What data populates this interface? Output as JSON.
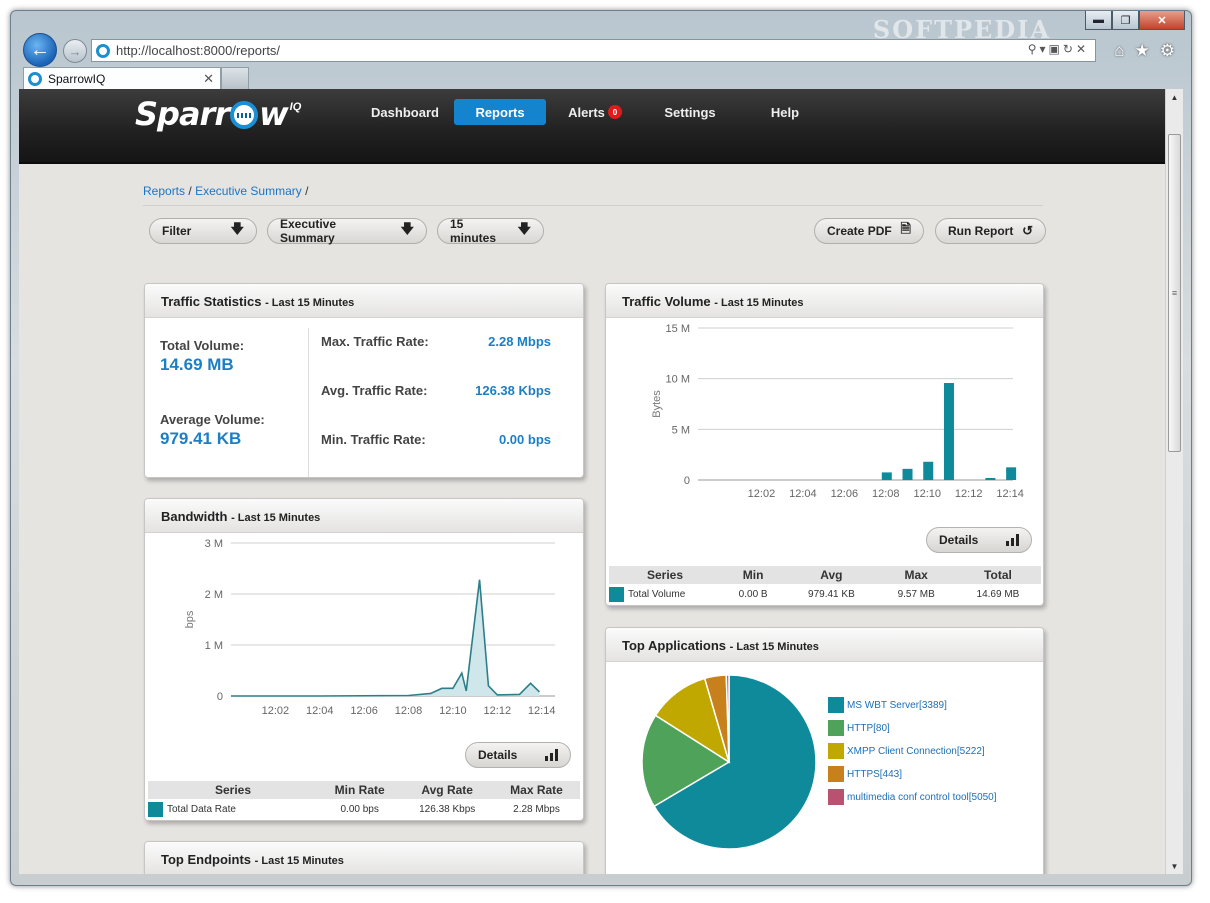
{
  "browser": {
    "watermark": "SOFTPEDIA",
    "url": "http://localhost:8000/reports/",
    "tab_title": "SparrowIQ",
    "controls": {
      "minimize": "▬",
      "maximize": "❐",
      "close": "✕"
    },
    "icons": [
      "home-icon",
      "star-icon",
      "gear-icon"
    ]
  },
  "app": {
    "logo": {
      "word_start": "Sparr",
      "word_end": "w",
      "sup": "IQ"
    },
    "nav": [
      {
        "label": "Dashboard",
        "active": false
      },
      {
        "label": "Reports",
        "active": true
      },
      {
        "label": "Alerts",
        "active": false,
        "badge": "0"
      },
      {
        "label": "Settings",
        "active": false
      },
      {
        "label": "Help",
        "active": false
      }
    ],
    "accent": "#1584cf",
    "badge_color": "#e01b1b"
  },
  "breadcrumb": {
    "items": [
      "Reports",
      "Executive Summary"
    ],
    "separator": "/"
  },
  "toolbar": {
    "filter": "Filter",
    "report": "Executive Summary",
    "time": "15 minutes",
    "create_pdf": "Create PDF",
    "run_report": "Run Report"
  },
  "traffic_stats": {
    "title": "Traffic Statistics",
    "subtitle": "- Last 15 Minutes",
    "total_volume_label": "Total Volume:",
    "total_volume": "14.69 MB",
    "average_volume_label": "Average Volume:",
    "average_volume": "979.41 KB",
    "max_rate_label": "Max. Traffic Rate:",
    "max_rate": "2.28 Mbps",
    "avg_rate_label": "Avg. Traffic Rate:",
    "avg_rate": "126.38 Kbps",
    "min_rate_label": "Min. Traffic Rate:",
    "min_rate": "0.00 bps"
  },
  "traffic_volume": {
    "title": "Traffic Volume",
    "subtitle": "- Last 15 Minutes",
    "details": "Details",
    "table": {
      "headers": [
        "Series",
        "Min",
        "Avg",
        "Max",
        "Total"
      ],
      "row": {
        "series": "Total Volume",
        "min": "0.00 B",
        "avg": "979.41 KB",
        "max": "9.57 MB",
        "total": "14.69 MB"
      }
    }
  },
  "bandwidth": {
    "title": "Bandwidth",
    "subtitle": "- Last 15 Minutes",
    "details": "Details",
    "table": {
      "headers": [
        "Series",
        "Min Rate",
        "Avg Rate",
        "Max Rate"
      ],
      "row": {
        "series": "Total Data Rate",
        "min": "0.00 bps",
        "avg": "126.38 Kbps",
        "max": "2.28 Mbps"
      }
    }
  },
  "top_applications": {
    "title": "Top Applications",
    "subtitle": "- Last 15 Minutes"
  },
  "top_endpoints": {
    "title": "Top Endpoints",
    "subtitle": "- Last 15 Minutes"
  },
  "chart_data": [
    {
      "type": "bar",
      "ylabel": "Bytes",
      "yticks": [
        "0",
        "5 M",
        "10 M",
        "15 M"
      ],
      "xticks": [
        "12:02",
        "12:04",
        "12:06",
        "12:08",
        "12:10",
        "12:12",
        "12:14"
      ],
      "ylim": [
        0,
        15
      ],
      "unit": "M bytes",
      "color": "#0e8a9b",
      "series": [
        {
          "values": [
            {
              "x": "12:08",
              "y": 0.75
            },
            {
              "x": "12:09",
              "y": 1.1
            },
            {
              "x": "12:10",
              "y": 1.8
            },
            {
              "x": "12:11",
              "y": 9.57
            },
            {
              "x": "12:13",
              "y": 0.2
            },
            {
              "x": "12:14",
              "y": 1.25
            }
          ]
        }
      ],
      "grid": true
    },
    {
      "type": "area",
      "ylabel": "bps",
      "yticks": [
        "0",
        "1 M",
        "2 M",
        "3 M"
      ],
      "xticks": [
        "12:02",
        "12:04",
        "12:06",
        "12:08",
        "12:10",
        "12:12",
        "12:14"
      ],
      "ylim": [
        0,
        3
      ],
      "unit": "Mbps",
      "color": "#2c7f8a",
      "fill": "#cfe6ea",
      "series": [
        {
          "values": [
            {
              "t": 0,
              "y": 0.0
            },
            {
              "t": 4,
              "y": 0.0
            },
            {
              "t": 8,
              "y": 0.01
            },
            {
              "t": 9,
              "y": 0.05
            },
            {
              "t": 9.5,
              "y": 0.15
            },
            {
              "t": 10,
              "y": 0.15
            },
            {
              "t": 10.4,
              "y": 0.45
            },
            {
              "t": 10.6,
              "y": 0.1
            },
            {
              "t": 11.2,
              "y": 2.28
            },
            {
              "t": 11.6,
              "y": 0.2
            },
            {
              "t": 12,
              "y": 0.02
            },
            {
              "t": 13,
              "y": 0.03
            },
            {
              "t": 13.5,
              "y": 0.25
            },
            {
              "t": 13.9,
              "y": 0.08
            }
          ]
        }
      ],
      "grid": true
    },
    {
      "type": "pie",
      "slices": [
        {
          "name": "MS WBT Server[3389]",
          "value": 66.5,
          "color": "#0e8a9b"
        },
        {
          "name": "HTTP[80]",
          "value": 17.5,
          "color": "#4fa25a"
        },
        {
          "name": "XMPP Client Connection[5222]",
          "value": 11.5,
          "color": "#c0a800"
        },
        {
          "name": "HTTPS[443]",
          "value": 4.0,
          "color": "#c7801b"
        },
        {
          "name": "multimedia conf control tool[5050]",
          "value": 0.5,
          "color": "#b85270"
        }
      ]
    }
  ]
}
